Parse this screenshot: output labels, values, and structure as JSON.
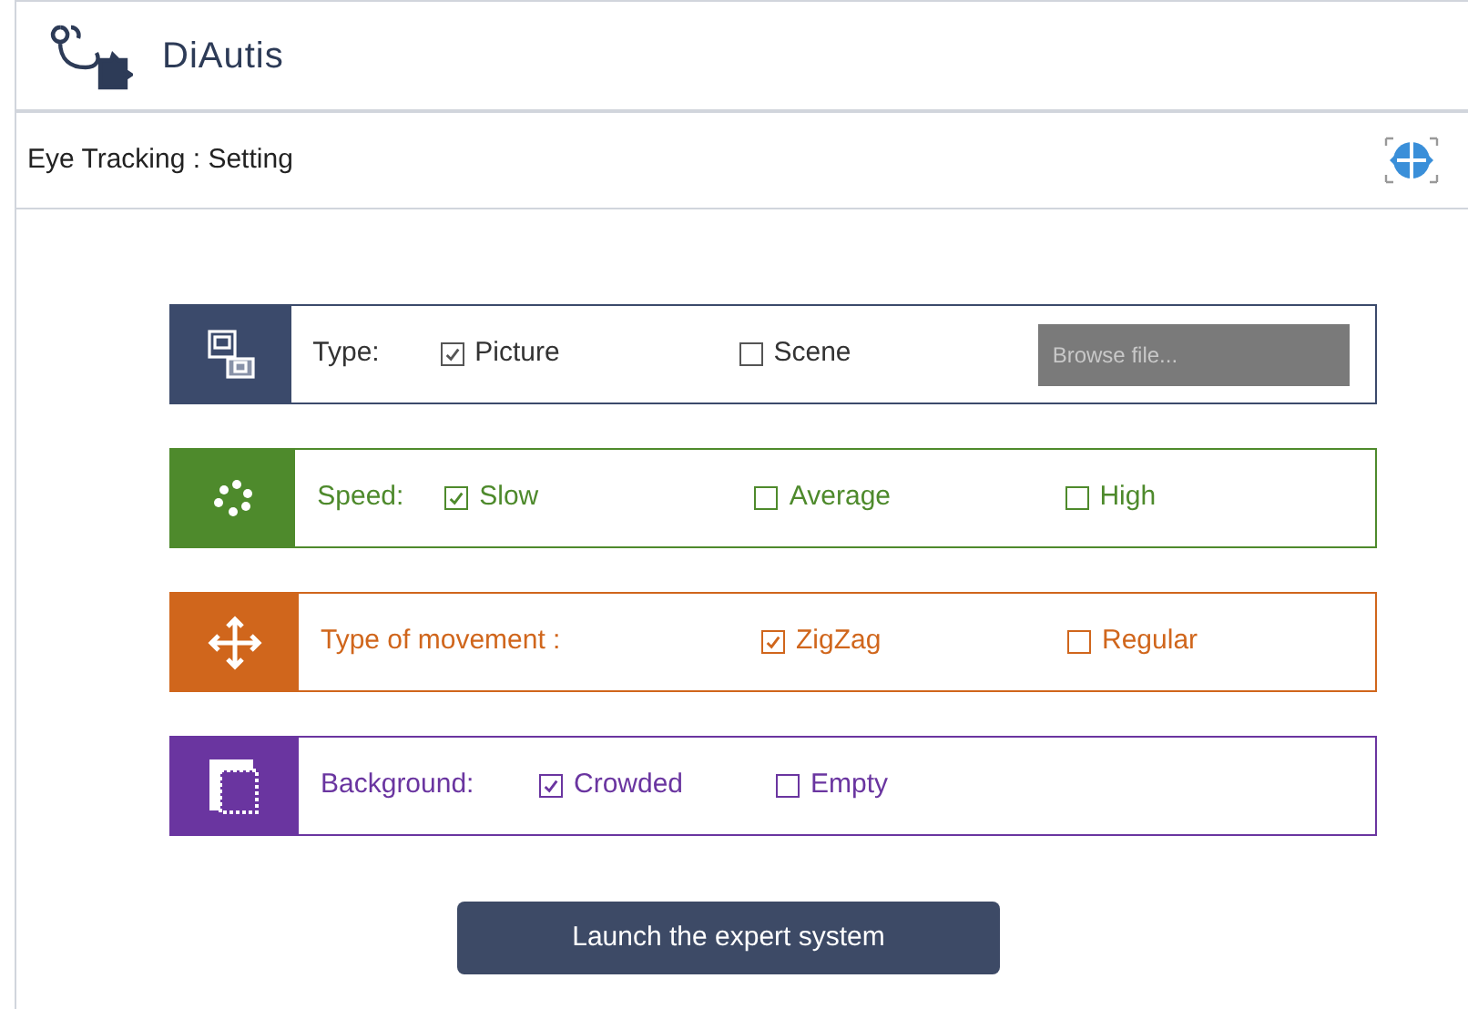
{
  "app": {
    "name": "DiAutis"
  },
  "page": {
    "title": "Eye Tracking : Setting"
  },
  "sections": [
    {
      "kind": "type",
      "color": "#3b4a6b",
      "label": "Type:",
      "options": [
        {
          "label": "Picture",
          "checked": true
        },
        {
          "label": "Scene",
          "checked": false
        }
      ],
      "browse": {
        "label": "Browse file..."
      }
    },
    {
      "kind": "speed",
      "color": "#4e8a2c",
      "label": "Speed:",
      "options": [
        {
          "label": "Slow",
          "checked": true
        },
        {
          "label": "Average",
          "checked": false
        },
        {
          "label": "High",
          "checked": false
        }
      ]
    },
    {
      "kind": "movement",
      "color": "#d0661c",
      "label": "Type of movement :",
      "options": [
        {
          "label": "ZigZag",
          "checked": true
        },
        {
          "label": "Regular",
          "checked": false
        }
      ]
    },
    {
      "kind": "background",
      "color": "#6a35a0",
      "label": "Background:",
      "options": [
        {
          "label": "Crowded",
          "checked": true
        },
        {
          "label": "Empty",
          "checked": false
        }
      ]
    }
  ],
  "launch_button": {
    "label": "Launch the expert system"
  }
}
